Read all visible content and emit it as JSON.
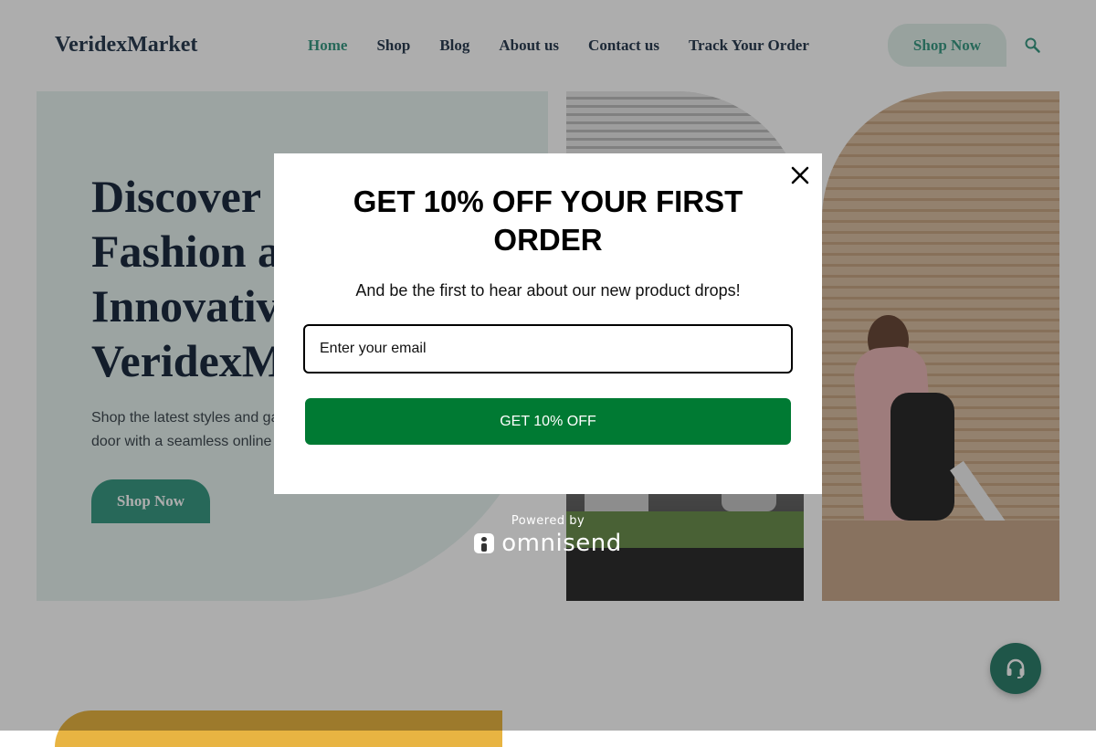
{
  "header": {
    "logo": "VeridexMarket",
    "nav": [
      {
        "label": "Home",
        "active": true
      },
      {
        "label": "Shop"
      },
      {
        "label": "Blog"
      },
      {
        "label": "About us"
      },
      {
        "label": "Contact us"
      },
      {
        "label": "Track Your Order"
      }
    ],
    "cta_label": "Shop Now",
    "search_icon": "search-icon"
  },
  "hero": {
    "title_lines": [
      "Discover '",
      "Fashion a",
      "Innovativ",
      "VeridexM"
    ],
    "subtitle_lines": [
      "Shop the latest styles and ga",
      "door with a seamless online"
    ],
    "cta_label": "Shop Now"
  },
  "modal": {
    "title": "GET 10% OFF YOUR FIRST ORDER",
    "subtitle": "And be the first to hear about our new product drops!",
    "email_placeholder": "Enter your email",
    "email_value": "",
    "submit_label": "GET 10% OFF",
    "close_icon": "close-icon"
  },
  "branding": {
    "powered_by": "Powered by",
    "brand": "omnisend"
  },
  "support": {
    "icon": "headset-icon"
  },
  "colors": {
    "accent": "#3a9a84",
    "hero_bg": "#e6f2ef",
    "heading": "#1c2c40",
    "cta_green": "#007a33",
    "overlay": "rgba(0,0,0,0.32)"
  }
}
